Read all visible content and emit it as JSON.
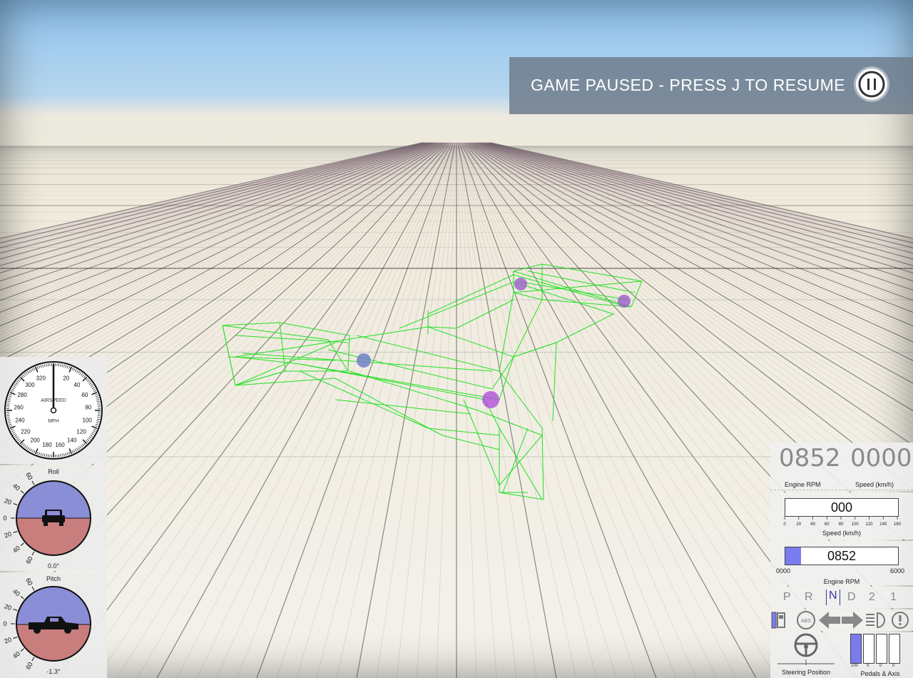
{
  "hud": {
    "pause_text": "GAME PAUSED - PRESS J TO RESUME"
  },
  "airspeed": {
    "label": "AIRSPEED",
    "unit": "MPH",
    "ticks": [
      "20",
      "40",
      "60",
      "80",
      "100",
      "120",
      "140",
      "160",
      "180",
      "200",
      "220",
      "240",
      "260",
      "280",
      "300",
      "320"
    ]
  },
  "roll": {
    "title": "Roll",
    "value": "0.0°",
    "scale": [
      "60",
      "40",
      "20",
      "0",
      "20",
      "40",
      "60"
    ]
  },
  "pitch": {
    "title": "Pitch",
    "value": "-1.3°",
    "scale": [
      "60",
      "40",
      "20",
      "0",
      "20",
      "40",
      "60"
    ]
  },
  "dashboard": {
    "rpm_digits": "0852",
    "speed_digits": "0000",
    "rpm_label": "Engine RPM",
    "speed_label": "Speed (km/h)",
    "speed_bar_value": "000",
    "speed_ticks": [
      "0",
      "20",
      "40",
      "60",
      "80",
      "100",
      "120",
      "140",
      "160"
    ],
    "speed_bar_label": "Speed (km/h)",
    "rpm_bar_value": "0852",
    "rpm_fill_fraction": 0.142,
    "rpm_min": "0000",
    "rpm_max": "6000",
    "rpm_bar_label": "Engine RPM",
    "gears": [
      "P",
      "R",
      "N",
      "D",
      "2",
      "1"
    ],
    "active_gear": "N",
    "icons": [
      "fuel-icon",
      "abs-icon",
      "turn-left-icon",
      "turn-right-icon",
      "headlight-icon",
      "warning-icon"
    ],
    "abs_text": "ABS",
    "steering_label": "Steering Position",
    "pedals_label": "Pedals & Axis",
    "pedal_values": [
      "100",
      "0",
      "0",
      "0"
    ]
  },
  "colors": {
    "wireframe": "#22e022",
    "gauge_sky": "#8a8ed6",
    "gauge_ground": "#c97e7e",
    "bar_fill": "#7b7bf0"
  }
}
